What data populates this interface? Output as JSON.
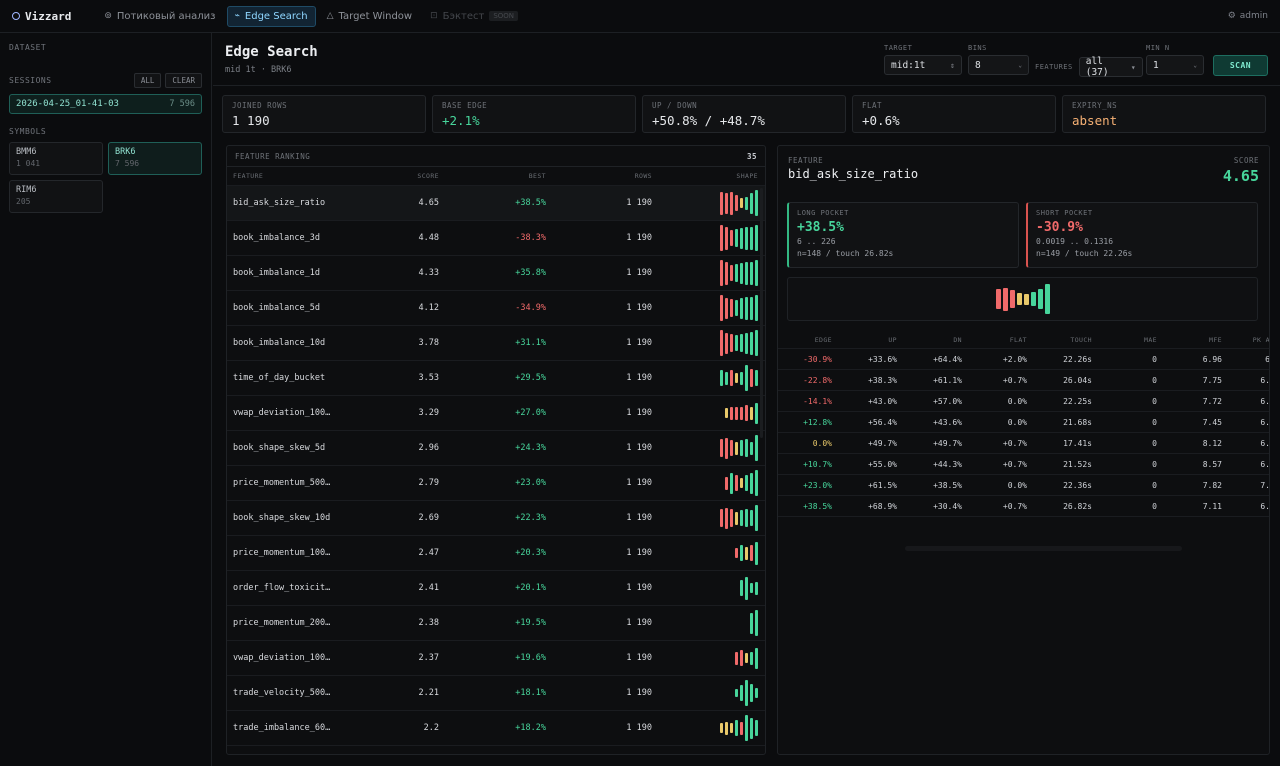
{
  "app": {
    "brand": "Vizzard",
    "user": "admin"
  },
  "nav": [
    {
      "icon": "⊚",
      "label": "Потиковый анализ",
      "state": "normal"
    },
    {
      "icon": "⌁",
      "label": "Edge Search",
      "state": "active"
    },
    {
      "icon": "△",
      "label": "Target Window",
      "state": "normal"
    },
    {
      "icon": "⊡",
      "label": "Бэктест",
      "state": "disabled",
      "badge": "SOON"
    }
  ],
  "sidebar": {
    "dataset_label": "DATASET",
    "sessions_label": "SESSIONS",
    "all_label": "ALL",
    "clear_label": "CLEAR",
    "session": {
      "name": "2026-04-25_01-41-03",
      "count": "7 596"
    },
    "symbols_label": "SYMBOLS",
    "symbols": [
      {
        "name": "BMM6",
        "count": "1 041",
        "active": false
      },
      {
        "name": "BRK6",
        "count": "7 596",
        "active": true
      },
      {
        "name": "RIM6",
        "count": "205",
        "active": false
      }
    ]
  },
  "header": {
    "title": "Edge Search",
    "subtitle": "mid 1t · BRK6",
    "target_label": "TARGET",
    "target_value": "mid:1t",
    "bins_label": "BINS",
    "bins_value": "8",
    "features_label": "FEATURES",
    "features_value": "all (37)",
    "minn_label": "MIN N",
    "minn_value": "1",
    "scan_label": "SCAN"
  },
  "stats": [
    {
      "label": "JOINED ROWS",
      "value": "1 190",
      "tone": "plain"
    },
    {
      "label": "BASE EDGE",
      "value": "+2.1%",
      "tone": "green"
    },
    {
      "label": "UP / DOWN",
      "value": "+50.8% / +48.7%",
      "tone": "plain"
    },
    {
      "label": "FLAT",
      "value": "+0.6%",
      "tone": "plain"
    },
    {
      "label": "EXPIRY_NS",
      "value": "absent",
      "tone": "orange"
    }
  ],
  "colors": {
    "green": "#47d59b",
    "red": "#f06a6a",
    "yellow": "#e8c86a",
    "accent": "#8fd6ff"
  },
  "ranking": {
    "title": "FEATURE RANKING",
    "count": "35",
    "columns": [
      "FEATURE",
      "SCORE",
      "BEST",
      "ROWS",
      "SHAPE"
    ],
    "rows": [
      {
        "name": "bid_ask_size_ratio",
        "score": "4.65",
        "best": "+38.5%",
        "rows": "1 190",
        "selected": true,
        "shape": [
          {
            "h": 0.9,
            "c": "r"
          },
          {
            "h": 0.8,
            "c": "r"
          },
          {
            "h": 0.9,
            "c": "r"
          },
          {
            "h": 0.6,
            "c": "r"
          },
          {
            "h": 0.4,
            "c": "y"
          },
          {
            "h": 0.5,
            "c": "g"
          },
          {
            "h": 0.8,
            "c": "g"
          },
          {
            "h": 1.0,
            "c": "g"
          }
        ]
      },
      {
        "name": "book_imbalance_3d",
        "score": "4.48",
        "best": "-38.3%",
        "rows": "1 190",
        "shape": [
          {
            "h": 1.0,
            "c": "r"
          },
          {
            "h": 0.9,
            "c": "r"
          },
          {
            "h": 0.6,
            "c": "r"
          },
          {
            "h": 0.7,
            "c": "g"
          },
          {
            "h": 0.8,
            "c": "g"
          },
          {
            "h": 0.9,
            "c": "g"
          },
          {
            "h": 0.9,
            "c": "g"
          },
          {
            "h": 1.0,
            "c": "g"
          }
        ]
      },
      {
        "name": "book_imbalance_1d",
        "score": "4.33",
        "best": "+35.8%",
        "rows": "1 190",
        "shape": [
          {
            "h": 1.0,
            "c": "r"
          },
          {
            "h": 0.9,
            "c": "r"
          },
          {
            "h": 0.6,
            "c": "r"
          },
          {
            "h": 0.7,
            "c": "g"
          },
          {
            "h": 0.8,
            "c": "g"
          },
          {
            "h": 0.9,
            "c": "g"
          },
          {
            "h": 0.9,
            "c": "g"
          },
          {
            "h": 1.0,
            "c": "g"
          }
        ]
      },
      {
        "name": "book_imbalance_5d",
        "score": "4.12",
        "best": "-34.9%",
        "rows": "1 190",
        "shape": [
          {
            "h": 1.0,
            "c": "r"
          },
          {
            "h": 0.8,
            "c": "r"
          },
          {
            "h": 0.7,
            "c": "r"
          },
          {
            "h": 0.6,
            "c": "g"
          },
          {
            "h": 0.8,
            "c": "g"
          },
          {
            "h": 0.9,
            "c": "g"
          },
          {
            "h": 0.9,
            "c": "g"
          },
          {
            "h": 1.0,
            "c": "g"
          }
        ]
      },
      {
        "name": "book_imbalance_10d",
        "score": "3.78",
        "best": "+31.1%",
        "rows": "1 190",
        "shape": [
          {
            "h": 1.0,
            "c": "r"
          },
          {
            "h": 0.8,
            "c": "r"
          },
          {
            "h": 0.7,
            "c": "r"
          },
          {
            "h": 0.6,
            "c": "g"
          },
          {
            "h": 0.7,
            "c": "g"
          },
          {
            "h": 0.8,
            "c": "g"
          },
          {
            "h": 0.9,
            "c": "g"
          },
          {
            "h": 1.0,
            "c": "g"
          }
        ]
      },
      {
        "name": "time_of_day_bucket",
        "score": "3.53",
        "best": "+29.5%",
        "rows": "1 190",
        "shape": [
          {
            "h": 0.6,
            "c": "g"
          },
          {
            "h": 0.5,
            "c": "g"
          },
          {
            "h": 0.6,
            "c": "r"
          },
          {
            "h": 0.4,
            "c": "y"
          },
          {
            "h": 0.5,
            "c": "g"
          },
          {
            "h": 1.0,
            "c": "g"
          },
          {
            "h": 0.7,
            "c": "r"
          },
          {
            "h": 0.6,
            "c": "g"
          }
        ]
      },
      {
        "name": "vwap_deviation_100…",
        "score": "3.29",
        "best": "+27.0%",
        "rows": "1 190",
        "shape": [
          {
            "h": 0.4,
            "c": "y"
          },
          {
            "h": 0.5,
            "c": "r"
          },
          {
            "h": 0.5,
            "c": "r"
          },
          {
            "h": 0.5,
            "c": "r"
          },
          {
            "h": 0.6,
            "c": "r"
          },
          {
            "h": 0.5,
            "c": "y"
          },
          {
            "h": 0.8,
            "c": "g"
          }
        ]
      },
      {
        "name": "book_shape_skew_5d",
        "score": "2.96",
        "best": "+24.3%",
        "rows": "1 190",
        "shape": [
          {
            "h": 0.7,
            "c": "r"
          },
          {
            "h": 0.8,
            "c": "r"
          },
          {
            "h": 0.6,
            "c": "r"
          },
          {
            "h": 0.5,
            "c": "y"
          },
          {
            "h": 0.6,
            "c": "g"
          },
          {
            "h": 0.7,
            "c": "g"
          },
          {
            "h": 0.5,
            "c": "g"
          },
          {
            "h": 1.0,
            "c": "g"
          }
        ]
      },
      {
        "name": "price_momentum_500…",
        "score": "2.79",
        "best": "+23.0%",
        "rows": "1 190",
        "shape": [
          {
            "h": 0.5,
            "c": "r"
          },
          {
            "h": 0.8,
            "c": "g"
          },
          {
            "h": 0.6,
            "c": "r"
          },
          {
            "h": 0.4,
            "c": "y"
          },
          {
            "h": 0.6,
            "c": "g"
          },
          {
            "h": 0.8,
            "c": "g"
          },
          {
            "h": 1.0,
            "c": "g"
          }
        ]
      },
      {
        "name": "book_shape_skew_10d",
        "score": "2.69",
        "best": "+22.3%",
        "rows": "1 190",
        "shape": [
          {
            "h": 0.7,
            "c": "r"
          },
          {
            "h": 0.8,
            "c": "r"
          },
          {
            "h": 0.7,
            "c": "r"
          },
          {
            "h": 0.5,
            "c": "y"
          },
          {
            "h": 0.6,
            "c": "g"
          },
          {
            "h": 0.7,
            "c": "g"
          },
          {
            "h": 0.6,
            "c": "g"
          },
          {
            "h": 1.0,
            "c": "g"
          }
        ]
      },
      {
        "name": "price_momentum_100…",
        "score": "2.47",
        "best": "+20.3%",
        "rows": "1 190",
        "shape": [
          {
            "h": 0.4,
            "c": "r"
          },
          {
            "h": 0.6,
            "c": "g"
          },
          {
            "h": 0.5,
            "c": "y"
          },
          {
            "h": 0.6,
            "c": "r"
          },
          {
            "h": 0.9,
            "c": "g"
          }
        ]
      },
      {
        "name": "order_flow_toxicit…",
        "score": "2.41",
        "best": "+20.1%",
        "rows": "1 190",
        "shape": [
          {
            "h": 0.6,
            "c": "g"
          },
          {
            "h": 0.9,
            "c": "g"
          },
          {
            "h": 0.4,
            "c": "g"
          },
          {
            "h": 0.5,
            "c": "g"
          }
        ]
      },
      {
        "name": "price_momentum_200…",
        "score": "2.38",
        "best": "+19.5%",
        "rows": "1 190",
        "shape": [
          {
            "h": 0.8,
            "c": "g"
          },
          {
            "h": 1.0,
            "c": "g"
          }
        ]
      },
      {
        "name": "vwap_deviation_100…",
        "score": "2.37",
        "best": "+19.6%",
        "rows": "1 190",
        "shape": [
          {
            "h": 0.5,
            "c": "r"
          },
          {
            "h": 0.6,
            "c": "r"
          },
          {
            "h": 0.4,
            "c": "y"
          },
          {
            "h": 0.5,
            "c": "g"
          },
          {
            "h": 0.8,
            "c": "g"
          }
        ]
      },
      {
        "name": "trade_velocity_500…",
        "score": "2.21",
        "best": "+18.1%",
        "rows": "1 190",
        "shape": [
          {
            "h": 0.3,
            "c": "g"
          },
          {
            "h": 0.6,
            "c": "g"
          },
          {
            "h": 1.0,
            "c": "g"
          },
          {
            "h": 0.7,
            "c": "g"
          },
          {
            "h": 0.4,
            "c": "g"
          }
        ]
      },
      {
        "name": "trade_imbalance_60…",
        "score": "2.2",
        "best": "+18.2%",
        "rows": "1 190",
        "shape": [
          {
            "h": 0.4,
            "c": "y"
          },
          {
            "h": 0.5,
            "c": "y"
          },
          {
            "h": 0.4,
            "c": "y"
          },
          {
            "h": 0.6,
            "c": "g"
          },
          {
            "h": 0.5,
            "c": "r"
          },
          {
            "h": 1.0,
            "c": "g"
          },
          {
            "h": 0.8,
            "c": "g"
          },
          {
            "h": 0.6,
            "c": "g"
          }
        ]
      }
    ]
  },
  "detail": {
    "feature_label": "FEATURE",
    "feature_name": "bid_ask_size_ratio",
    "score_label": "SCORE",
    "score": "4.65",
    "long": {
      "label": "LONG POCKET",
      "value": "+38.5%",
      "range": "6 .. 226",
      "ntouch": "n=148 / touch 26.82s"
    },
    "short": {
      "label": "SHORT POCKET",
      "value": "-30.9%",
      "range": "0.0019 .. 0.1316",
      "ntouch": "n=149 / touch 22.26s"
    },
    "shape": [
      {
        "h": 0.65,
        "c": "r"
      },
      {
        "h": 0.75,
        "c": "r"
      },
      {
        "h": 0.6,
        "c": "r"
      },
      {
        "h": 0.4,
        "c": "y"
      },
      {
        "h": 0.35,
        "c": "y"
      },
      {
        "h": 0.45,
        "c": "g"
      },
      {
        "h": 0.65,
        "c": "g"
      },
      {
        "h": 1.0,
        "c": "g"
      }
    ],
    "columns": [
      "EDGE",
      "UP",
      "DN",
      "FLAT",
      "TOUCH",
      "MAE",
      "MFE",
      "PK A"
    ],
    "rows": [
      {
        "edge": "-30.9%",
        "tone": "red",
        "up": "+33.6%",
        "dn": "+64.4%",
        "flat": "+2.0%",
        "touch": "22.26s",
        "mae": "0",
        "mfe": "6.96",
        "pk": "6"
      },
      {
        "edge": "-22.8%",
        "tone": "red",
        "up": "+38.3%",
        "dn": "+61.1%",
        "flat": "+0.7%",
        "touch": "26.04s",
        "mae": "0",
        "mfe": "7.75",
        "pk": "6."
      },
      {
        "edge": "-14.1%",
        "tone": "red",
        "up": "+43.0%",
        "dn": "+57.0%",
        "flat": "0.0%",
        "touch": "22.25s",
        "mae": "0",
        "mfe": "7.72",
        "pk": "6."
      },
      {
        "edge": "+12.8%",
        "tone": "green",
        "up": "+56.4%",
        "dn": "+43.6%",
        "flat": "0.0%",
        "touch": "21.68s",
        "mae": "0",
        "mfe": "7.45",
        "pk": "6."
      },
      {
        "edge": "0.0%",
        "tone": "yellow",
        "up": "+49.7%",
        "dn": "+49.7%",
        "flat": "+0.7%",
        "touch": "17.41s",
        "mae": "0",
        "mfe": "8.12",
        "pk": "6."
      },
      {
        "edge": "+10.7%",
        "tone": "green",
        "up": "+55.0%",
        "dn": "+44.3%",
        "flat": "+0.7%",
        "touch": "21.52s",
        "mae": "0",
        "mfe": "8.57",
        "pk": "6."
      },
      {
        "edge": "+23.0%",
        "tone": "green",
        "up": "+61.5%",
        "dn": "+38.5%",
        "flat": "0.0%",
        "touch": "22.36s",
        "mae": "0",
        "mfe": "7.82",
        "pk": "7."
      },
      {
        "edge": "+38.5%",
        "tone": "green",
        "up": "+68.9%",
        "dn": "+30.4%",
        "flat": "+0.7%",
        "touch": "26.82s",
        "mae": "0",
        "mfe": "7.11",
        "pk": "6."
      }
    ]
  }
}
